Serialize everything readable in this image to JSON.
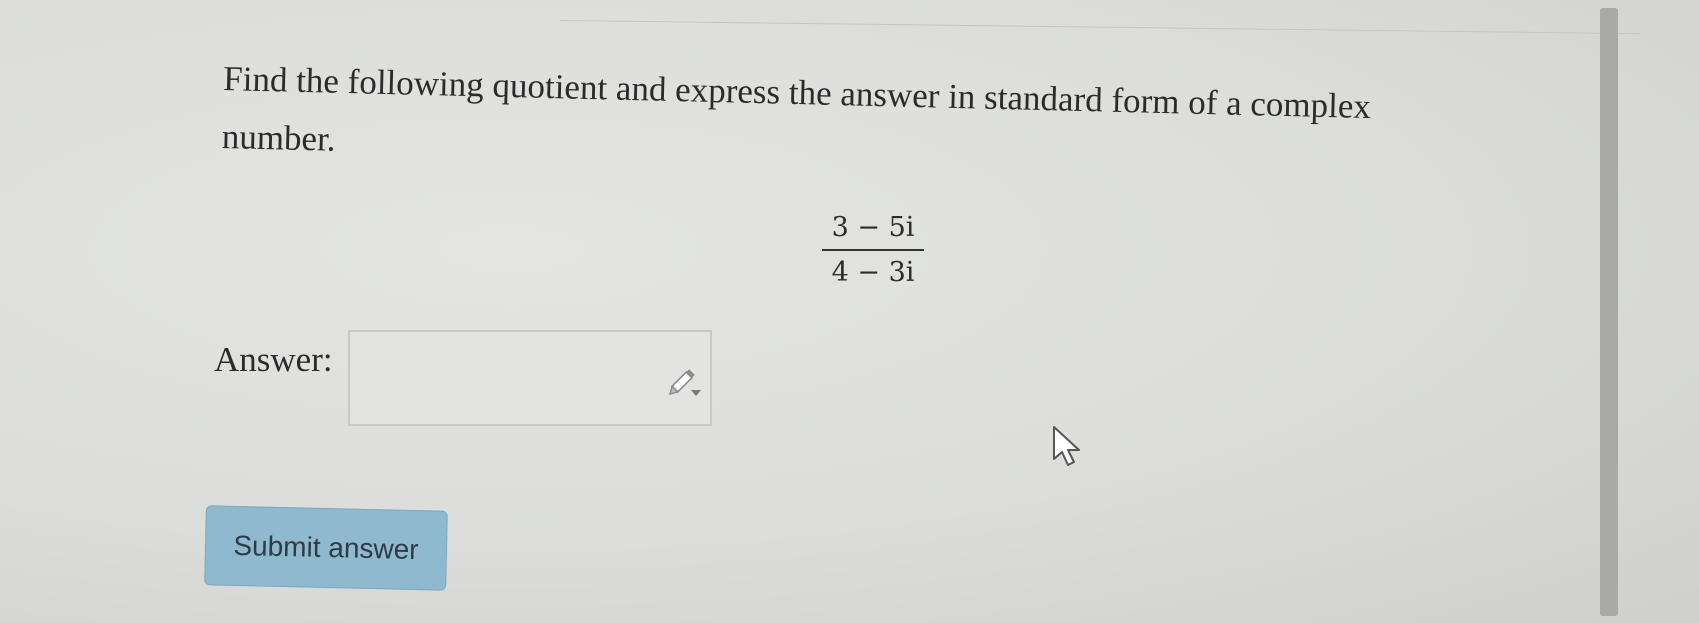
{
  "question": {
    "text": "Find the following quotient and express the answer in standard form of a complex number."
  },
  "expression": {
    "numerator": "3 − 5i",
    "denominator": "4 − 3i"
  },
  "answer": {
    "label": "Answer:",
    "value": ""
  },
  "submit": {
    "label": "Submit answer"
  },
  "icons": {
    "editor": "pencil-icon",
    "cursor": "mouse-pointer-icon"
  },
  "colors": {
    "button_bg": "#8fb9cf",
    "button_text": "#2f3b44",
    "scrollbar": "#a9aaa8"
  }
}
